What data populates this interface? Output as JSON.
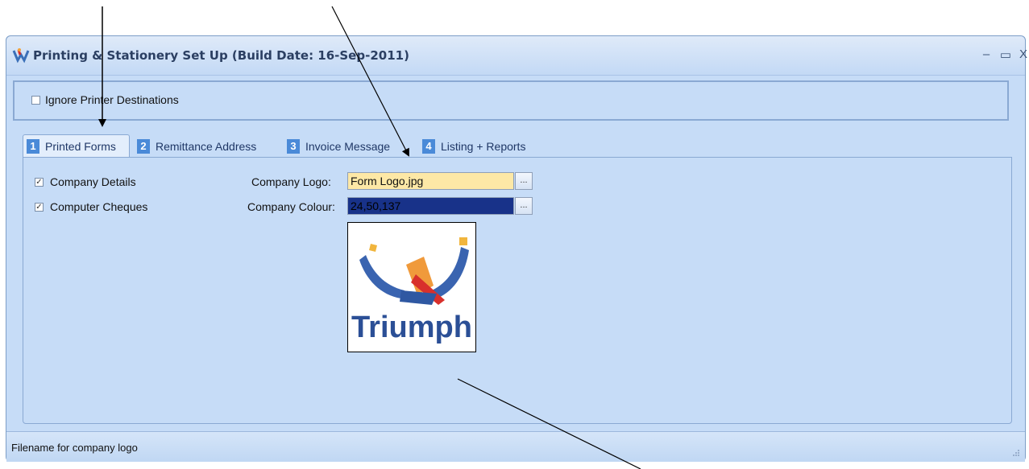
{
  "window": {
    "title": "Printing & Stationery Set Up (Build Date: 16-Sep-2011)",
    "controls": {
      "minimize": "–",
      "maximize": "▭",
      "close": "X"
    }
  },
  "options": {
    "ignore_printer_destinations": {
      "label": "Ignore Printer Destinations",
      "checked": false
    }
  },
  "tabs": [
    {
      "num": "1",
      "label": "Printed Forms",
      "active": true
    },
    {
      "num": "2",
      "label": "Remittance Address",
      "active": false
    },
    {
      "num": "3",
      "label": "Invoice Message",
      "active": false
    },
    {
      "num": "4",
      "label": "Listing + Reports",
      "active": false
    }
  ],
  "printed_forms": {
    "company_details": {
      "label": "Company Details",
      "checked": true,
      "mark": "✓"
    },
    "computer_cheques": {
      "label": "Computer Cheques",
      "checked": true,
      "mark": "✓"
    },
    "company_logo": {
      "label": "Company Logo:",
      "value": "Form Logo.jpg",
      "browse": "..."
    },
    "company_colour": {
      "label": "Company Colour:",
      "value": "24,50,137",
      "browse": "..."
    },
    "logo_text": "Triumph"
  },
  "status": {
    "text": "Filename for company logo"
  },
  "colors": {
    "logo_field_bg": "#fde8a6",
    "colour_field_bg": "#183289",
    "panel_bg": "#c6dcf7",
    "tab_number_bg": "#4a8ad8"
  }
}
